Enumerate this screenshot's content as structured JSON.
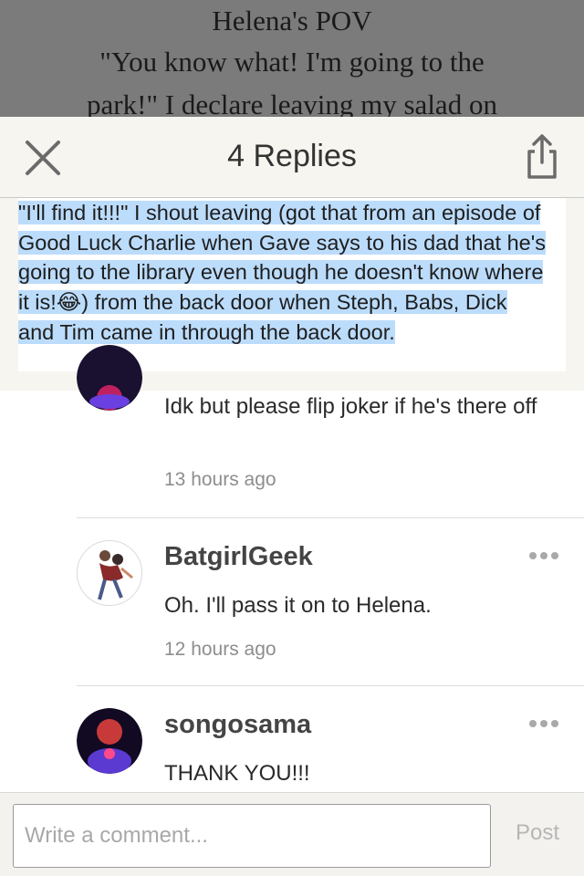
{
  "story": {
    "heading": "Helena's POV",
    "lines": [
      "\"You know what! I'm going to the",
      "park!\" I declare leaving my salad on"
    ]
  },
  "header": {
    "title": "4 Replies",
    "close_icon": "close-icon",
    "share_icon": "share-icon"
  },
  "quote": {
    "text": "\"I'll find it!!!\" I shout leaving (got that from an episode of Good Luck Charlie when Gave says to his dad that he's going to the library even though he doesn't know where it is!😂) from the back door when Steph, Babs, Dick and Tim came in through the back door."
  },
  "replies": [
    {
      "author": "",
      "text": "Idk but please flip joker if he's there off",
      "time": "13 hours ago"
    },
    {
      "author": "BatgirlGeek",
      "text": "Oh. I'll pass it on to Helena.",
      "time": "12 hours ago"
    },
    {
      "author": "songosama",
      "text": "THANK YOU!!!",
      "time": ""
    }
  ],
  "composer": {
    "placeholder": "Write a comment...",
    "post_label": "Post"
  },
  "colors": {
    "highlight": "#bcdcfb",
    "header_bg": "#f6f5ef",
    "overlay": "#7b7b7b"
  }
}
